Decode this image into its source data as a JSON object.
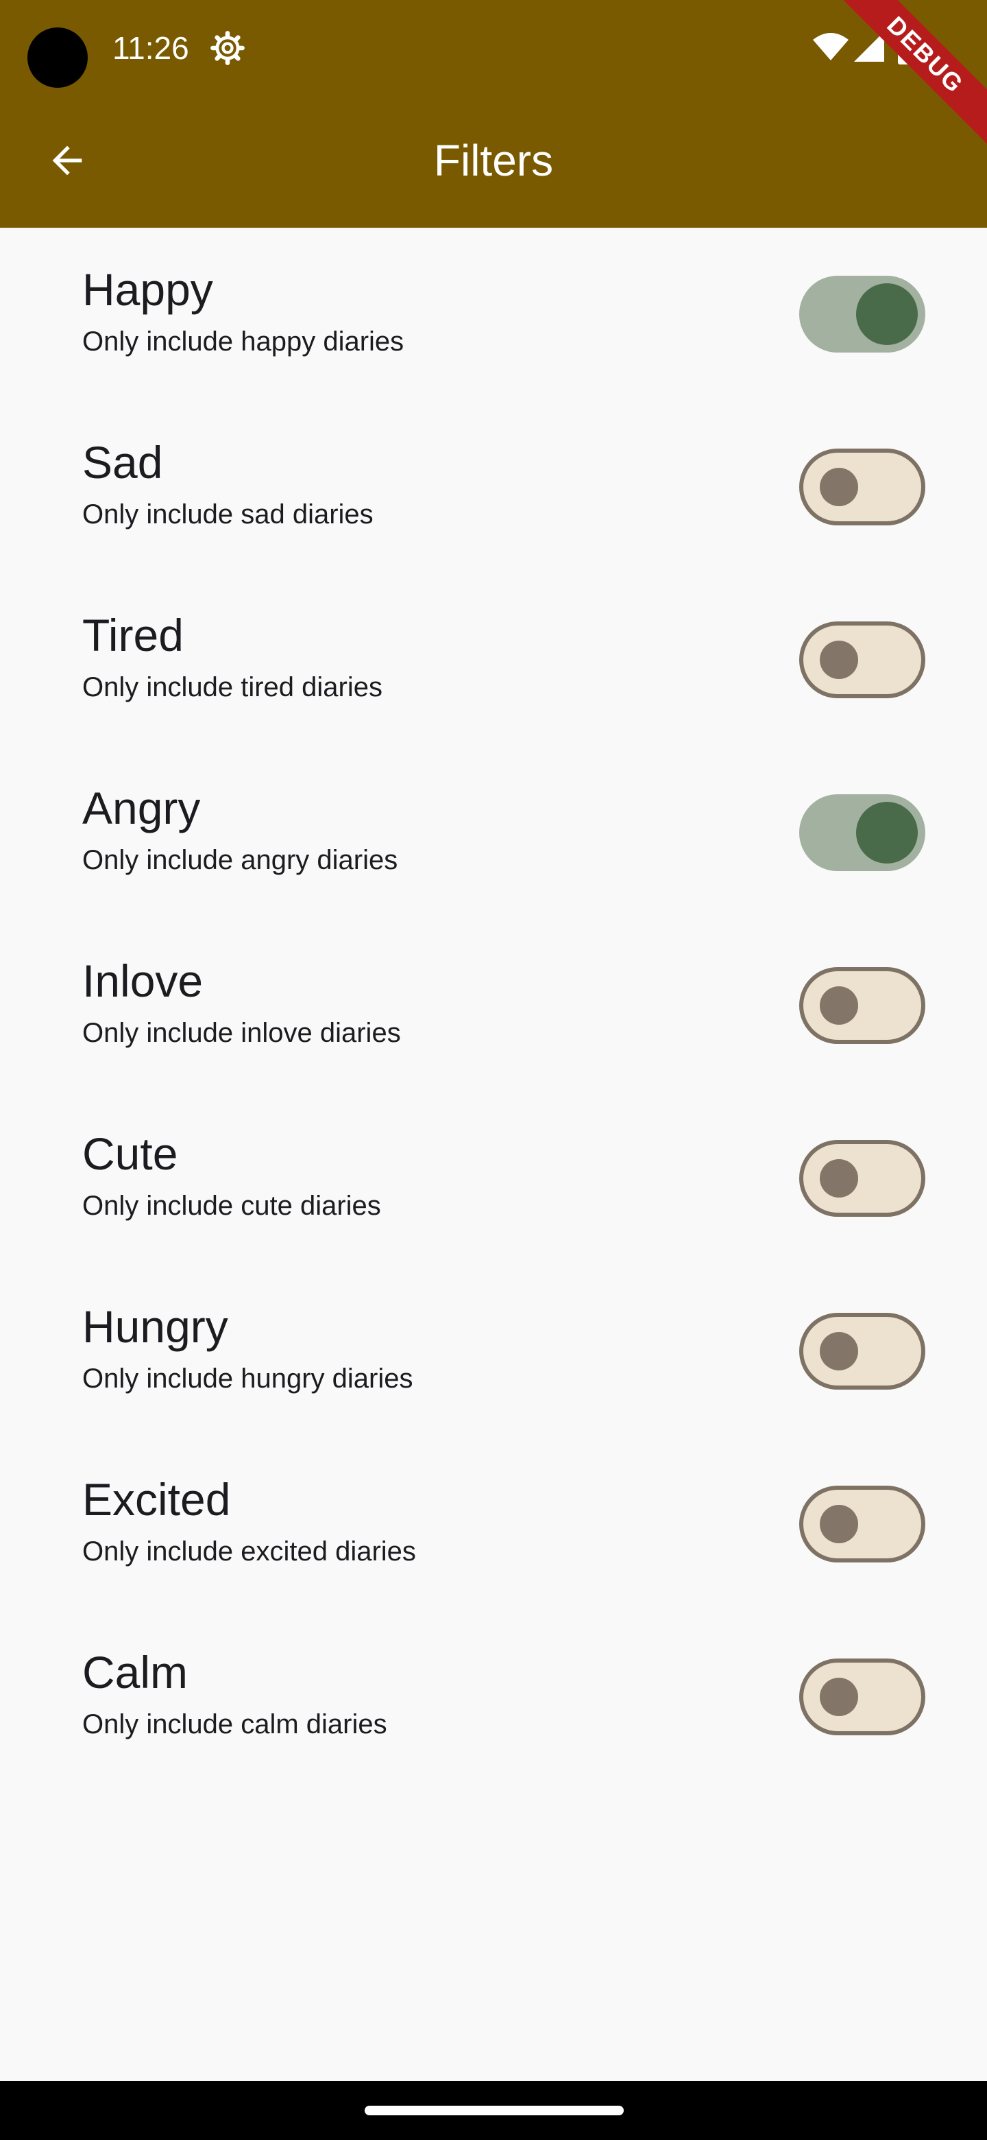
{
  "status_bar": {
    "time": "11:26"
  },
  "debug_banner": "DEBUG",
  "appbar": {
    "title": "Filters",
    "back_icon": "arrow-back-icon"
  },
  "filters": [
    {
      "title": "Happy",
      "subtitle": "Only include happy diaries",
      "enabled": true
    },
    {
      "title": "Sad",
      "subtitle": "Only include sad diaries",
      "enabled": false
    },
    {
      "title": "Tired",
      "subtitle": "Only include tired diaries",
      "enabled": false
    },
    {
      "title": "Angry",
      "subtitle": "Only include angry diaries",
      "enabled": true
    },
    {
      "title": "Inlove",
      "subtitle": "Only include inlove diaries",
      "enabled": false
    },
    {
      "title": "Cute",
      "subtitle": "Only include cute diaries",
      "enabled": false
    },
    {
      "title": "Hungry",
      "subtitle": "Only include hungry diaries",
      "enabled": false
    },
    {
      "title": "Excited",
      "subtitle": "Only include excited diaries",
      "enabled": false
    },
    {
      "title": "Calm",
      "subtitle": "Only include calm diaries",
      "enabled": false
    }
  ],
  "colors": {
    "appbar": "#7a5a00",
    "switch_on_track": "#a2b1a0",
    "switch_on_thumb": "#4a6b4a",
    "switch_off_track": "#ede1d0",
    "switch_off_thumb": "#837668"
  }
}
